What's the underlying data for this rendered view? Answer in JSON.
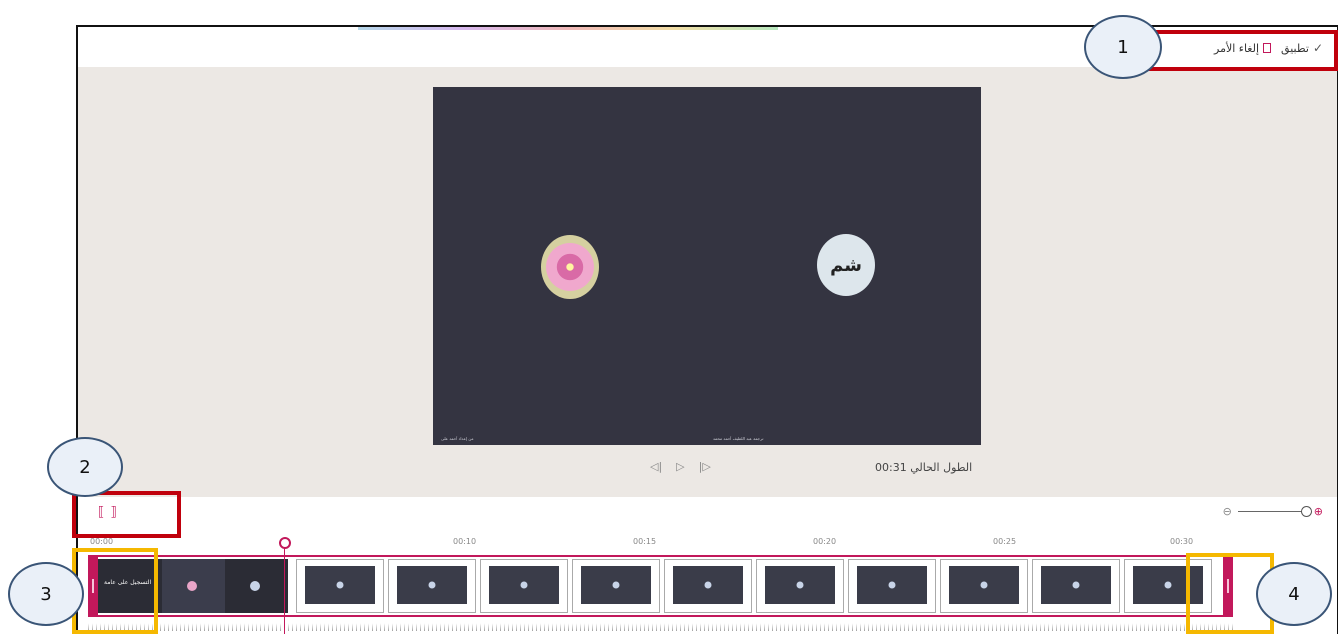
{
  "toolbar": {
    "apply_label": "تطبيق",
    "cancel_label": "إلغاء الأمر"
  },
  "preview": {
    "avatar_text": "شم",
    "footer_left": "من إعداد أحمد على",
    "footer_center": "ترجمة عبد اللطيف أحمد محمد"
  },
  "playback": {
    "duration_label": "الطول الحالي 00:31"
  },
  "timeline": {
    "ticks": [
      "00:00",
      "00:10",
      "00:15",
      "00:20",
      "00:25",
      "00:30"
    ],
    "first_clip_title": "التسجيل على عامة"
  },
  "callouts": [
    "1",
    "2",
    "3",
    "4"
  ],
  "colors": {
    "accent": "#c2185b",
    "red_highlight": "#c0000c",
    "yellow_highlight": "#f5b800",
    "video_bg": "#343441"
  }
}
